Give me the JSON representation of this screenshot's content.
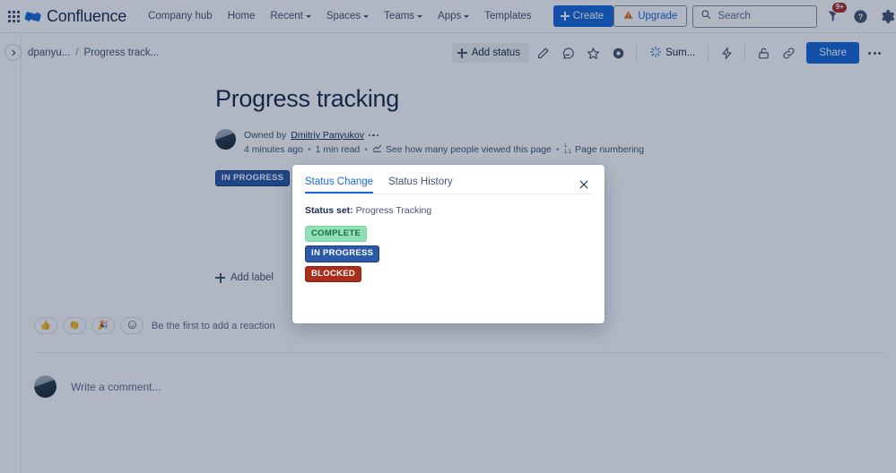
{
  "topnav": {
    "app_switcher": "app-switcher",
    "brand": "Confluence",
    "links": [
      {
        "label": "Company hub",
        "has_caret": false
      },
      {
        "label": "Home",
        "has_caret": false
      },
      {
        "label": "Recent",
        "has_caret": true
      },
      {
        "label": "Spaces",
        "has_caret": true
      },
      {
        "label": "Teams",
        "has_caret": true
      },
      {
        "label": "Apps",
        "has_caret": true
      },
      {
        "label": "Templates",
        "has_caret": false
      }
    ],
    "create_label": "Create",
    "upgrade_label": "Upgrade",
    "search_placeholder": "Search",
    "notification_count": "9+"
  },
  "pagebar": {
    "breadcrumb": {
      "space": "dpanyu...",
      "separator": "/",
      "page": "Progress track..."
    },
    "add_status_label": "Add status",
    "summarize_label": "Sum...",
    "share_label": "Share"
  },
  "page": {
    "title": "Progress tracking",
    "owned_by_prefix": "Owned by",
    "owner": "Dmitriy Panyukov",
    "updated": "4 minutes ago",
    "read_time": "1 min read",
    "views_label": "See how many people viewed this page",
    "numbering_label": "Page numbering",
    "numbering_glyph_top": "1",
    "numbering_glyph_bottom": "1.1",
    "status_lozenge": "IN PROGRESS",
    "add_label": "Add label",
    "reaction_hint": "Be the first to add a reaction",
    "reactions": [
      "👍",
      "👏",
      "🎉"
    ],
    "comment_placeholder": "Write a comment..."
  },
  "dialog": {
    "tabs": [
      {
        "label": "Status Change",
        "active": true
      },
      {
        "label": "Status History",
        "active": false
      }
    ],
    "status_set_label": "Status set:",
    "status_set_value": "Progress Tracking",
    "statuses": [
      {
        "label": "COMPLETE",
        "variant": "complete",
        "color": "#8fe0b4"
      },
      {
        "label": "IN PROGRESS",
        "variant": "inprogress",
        "color": "#2c59a8"
      },
      {
        "label": "BLOCKED",
        "variant": "blocked",
        "color": "#a92f1c"
      }
    ]
  },
  "colors": {
    "brand_blue": "#1868db",
    "text": "#172b4d",
    "subtle": "#44546f"
  }
}
